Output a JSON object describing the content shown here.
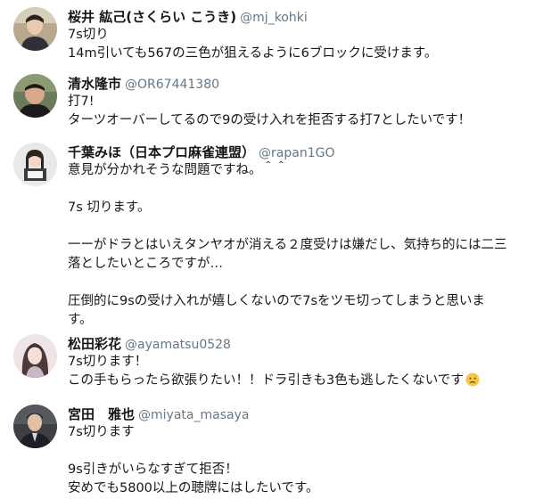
{
  "tweets": [
    {
      "name": "桜井 紘己(さくらい こうき)",
      "handle": "@mj_kohki",
      "avatar_icon": "user-avatar-icon",
      "lines": [
        "7s切り",
        "14m引いても567の三色が狙えるように6ブロックに受けます。"
      ]
    },
    {
      "name": "清水隆市",
      "handle": "@OR67441380",
      "avatar_icon": "user-avatar-icon",
      "lines": [
        "打7!",
        "ターツオーバーしてるので9の受け入れを拒否する打7としたいです！"
      ]
    },
    {
      "name": "千葉みほ（日本プロ麻雀連盟）",
      "handle": "@rapan1GO",
      "avatar_icon": "user-avatar-icon",
      "lines": [
        "意見が分かれそうな問題ですね。＾＾",
        "",
        "7s 切ります。",
        "",
        "一ーがドラとはいえタンヤオが消える２度受けは嫌だし、気持ち的には二三",
        "落としたいところですが…",
        "",
        "圧倒的に9sの受け入れが嬉しくないので7sをツモ切ってしまうと思いま",
        "す。"
      ]
    },
    {
      "name": "松田彩花",
      "handle": "@ayamatsu0528",
      "avatar_icon": "user-avatar-icon",
      "lines": [
        "7s切ります！",
        "この手もらったら欲張りたい！！ドラ引きも3色も逃したくないです"
      ],
      "emoji": "worried-face-icon"
    },
    {
      "name": "宮田　雅也",
      "handle": "@miyata_masaya",
      "avatar_icon": "user-avatar-icon",
      "lines": [
        "7s切ります",
        "",
        "9s引きがいらなすぎて拒否！",
        "安めでも5800以上の聴牌にはしたいです。"
      ]
    }
  ]
}
